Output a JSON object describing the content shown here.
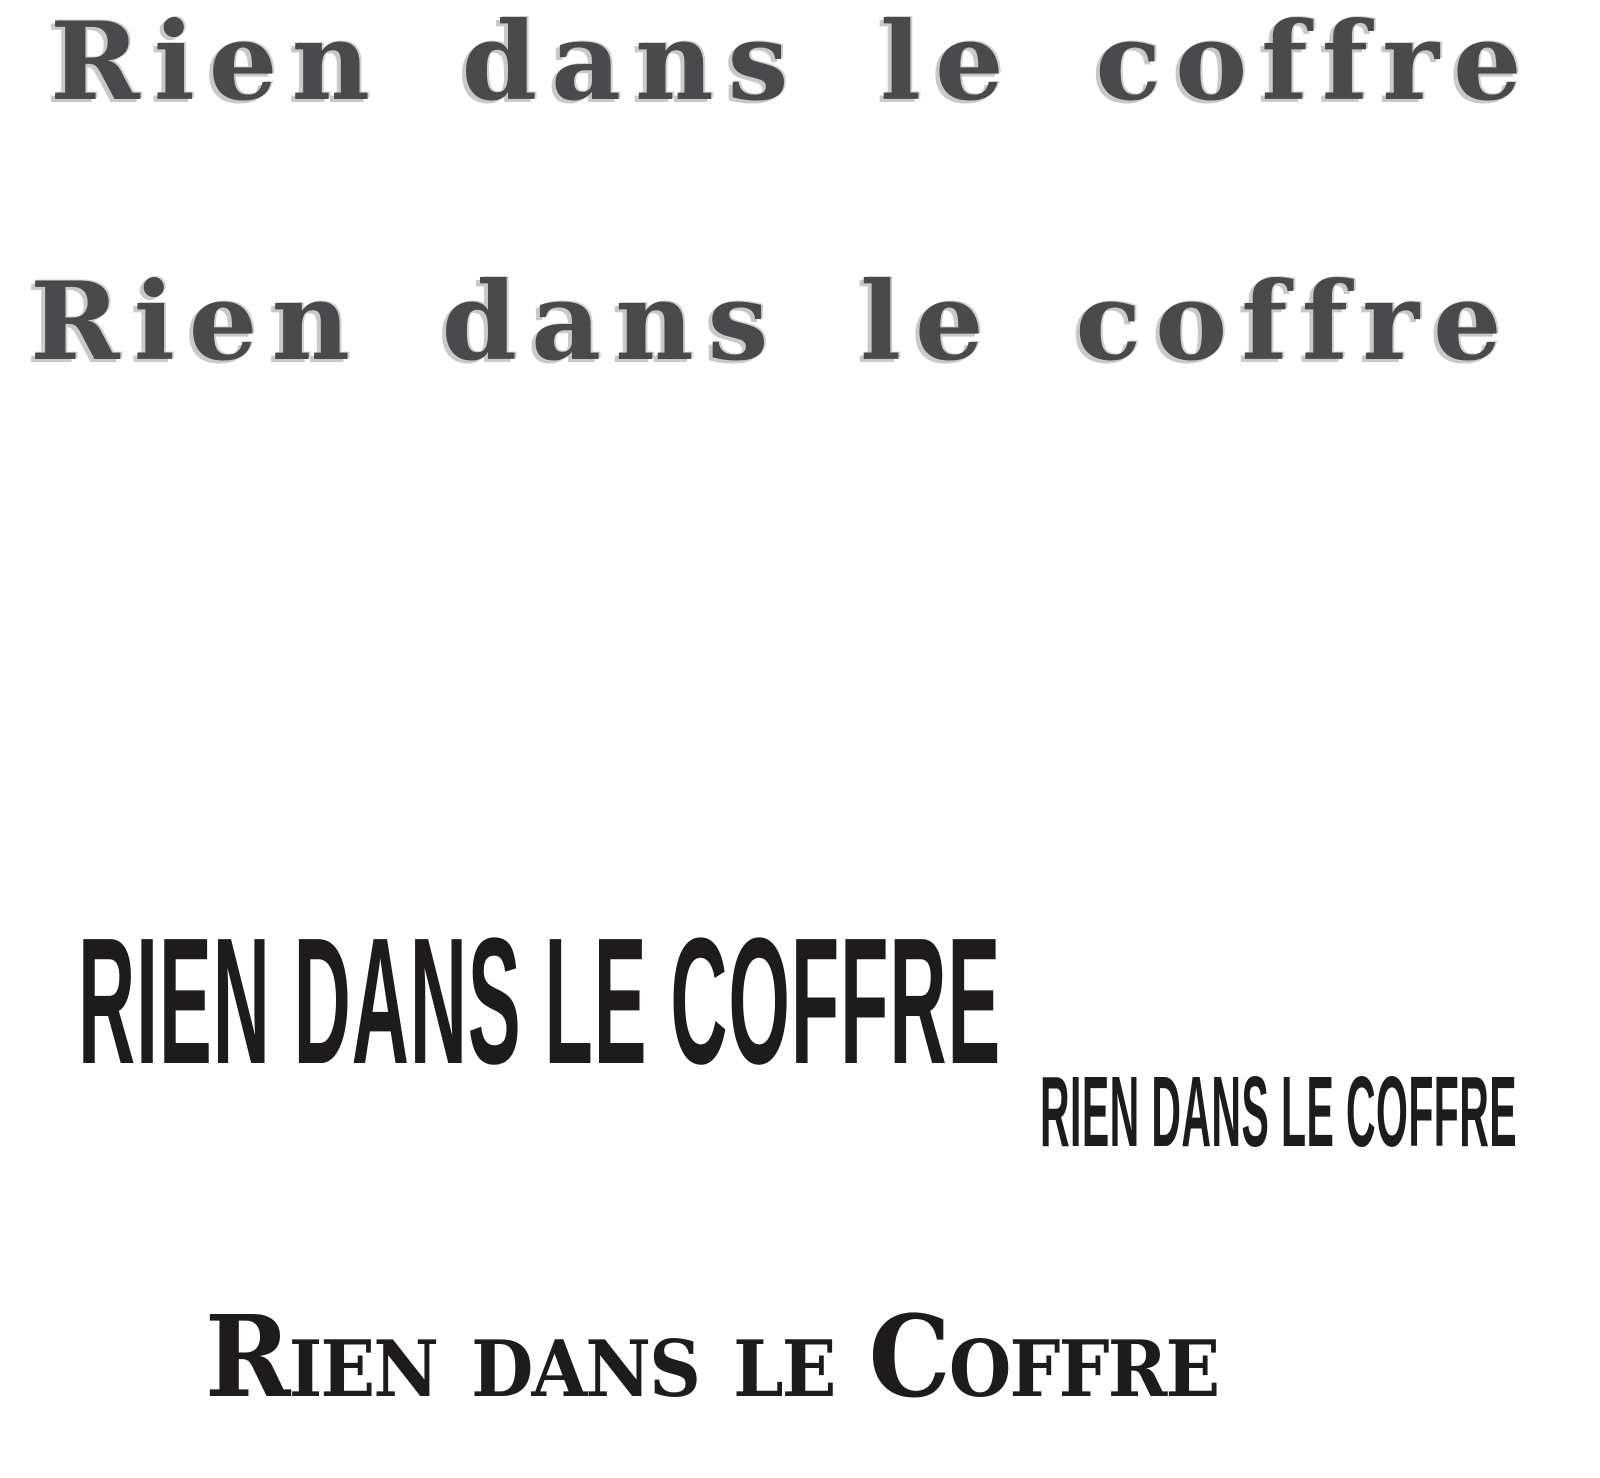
{
  "samples": {
    "typewriter_1": "Rien dans le coffre",
    "typewriter_2": "Rien dans le coffre",
    "condensed_large": "RIEN DANS LE COFFRE",
    "condensed_small": "RIEN DANS LE COFFRE",
    "smallcaps_serif": "Rien dans le Coffre"
  },
  "colors": {
    "typewriter_ink": "#4a4a4c",
    "typewriter_shadow": "#c9c9c9",
    "solid_ink": "#1e1b1b",
    "background": "#ffffff"
  }
}
